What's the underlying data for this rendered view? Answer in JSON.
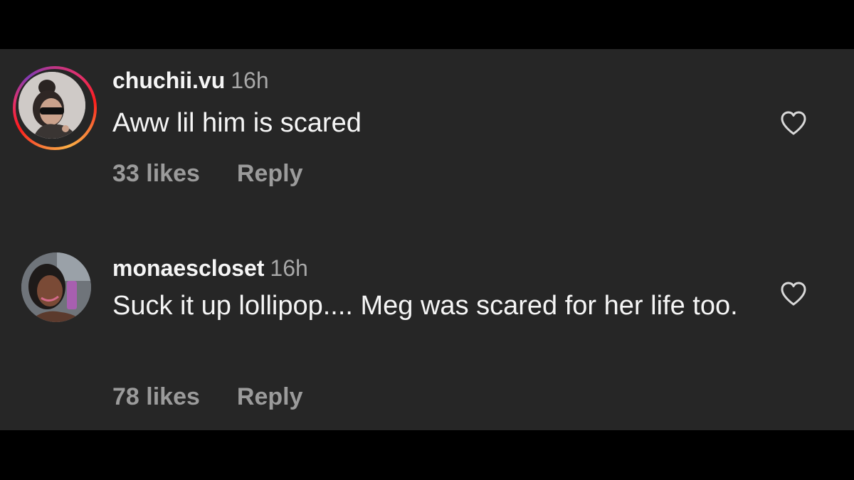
{
  "colors": {
    "background": "#000000",
    "panel": "#262626",
    "primary_text": "#f5f5f5",
    "secondary_text": "#a8a8a8",
    "action_text": "#9b9b9b"
  },
  "comments": [
    {
      "username": "chuchii.vu",
      "time": "16h",
      "text": "Aww lil him is scared",
      "likes": "33 likes",
      "reply_label": "Reply",
      "has_story_ring": true,
      "like_icon": "heart-outline-icon"
    },
    {
      "username": "monaescloset",
      "time": "16h",
      "text": "Suck it up lollipop.... Meg was scared for her life too.",
      "likes": "78 likes",
      "reply_label": "Reply",
      "has_story_ring": false,
      "like_icon": "heart-outline-icon"
    }
  ]
}
